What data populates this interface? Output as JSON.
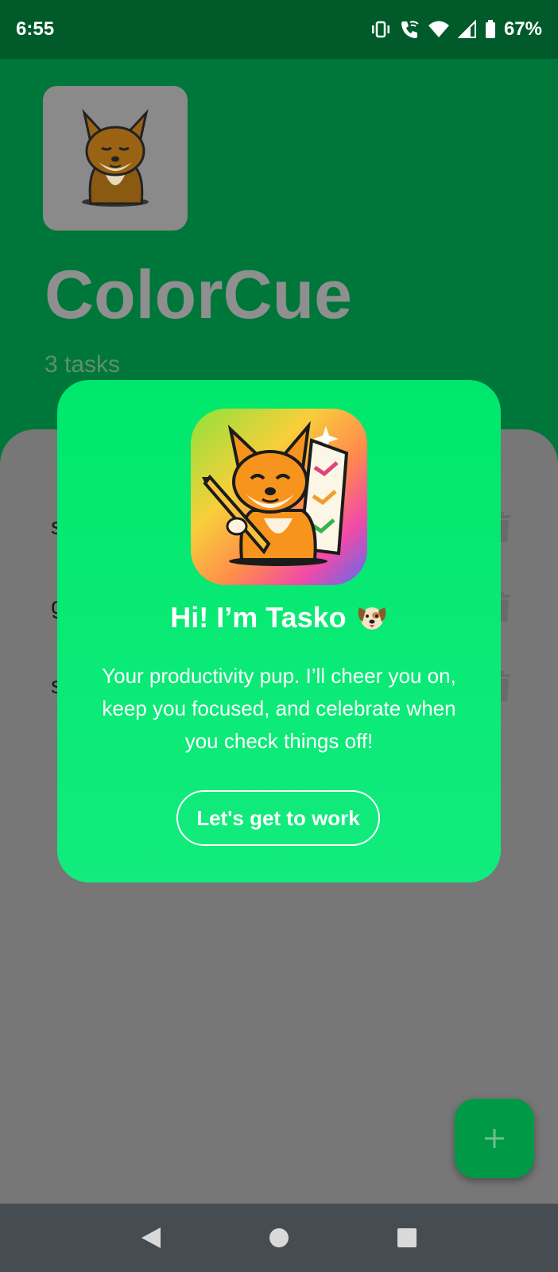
{
  "status_bar": {
    "time": "6:55",
    "battery": "67%",
    "icons": [
      "vibrate-icon",
      "wifi-call-icon",
      "wifi-icon",
      "cell-signal-icon",
      "battery-icon"
    ]
  },
  "header": {
    "logo_icon": "corgi-logo",
    "title": "ColorCue",
    "subtitle": "3 tasks"
  },
  "tasks": [
    {
      "label": "sleep",
      "delete_icon": "trash-icon"
    },
    {
      "label": "gym",
      "delete_icon": "trash-icon"
    },
    {
      "label": "study",
      "delete_icon": "trash-icon"
    }
  ],
  "fab": {
    "icon": "plus-icon"
  },
  "dialog": {
    "title": "Hi! I’m Tasko",
    "title_emoji": "dog-face-icon",
    "body": "Your productivity pup. I’ll cheer you on, keep you focused, and celebrate when you check things off!",
    "button_label": "Let's get to work"
  },
  "nav_bar": {
    "back": "back-icon",
    "home": "home-icon",
    "recents": "recents-icon"
  },
  "colors": {
    "status_bar": "#005a2a",
    "header": "#00773a",
    "dialog": "#00e86c",
    "fab": "#009a47",
    "scrim": "#777777",
    "nav_bar": "#454c52"
  }
}
